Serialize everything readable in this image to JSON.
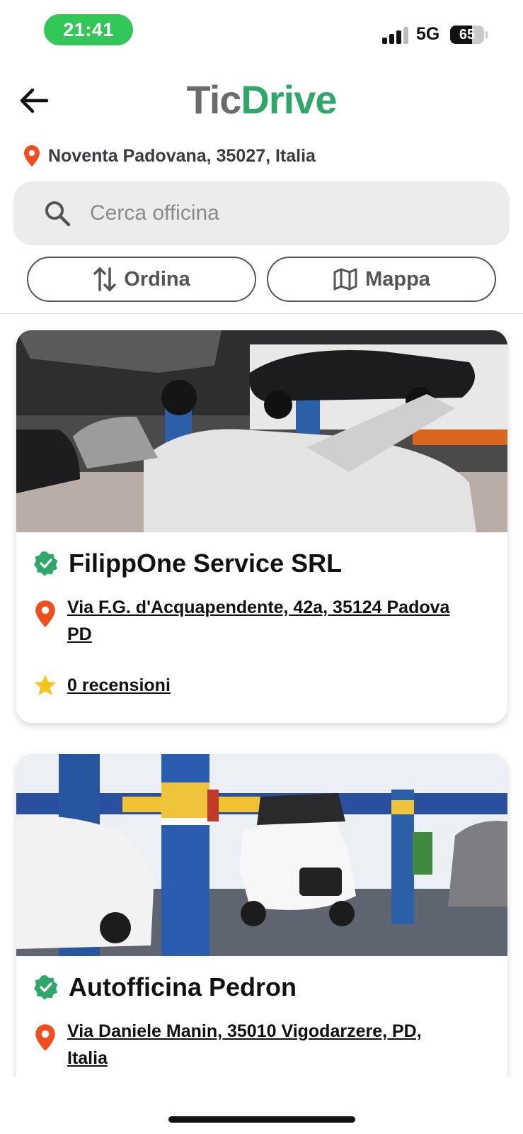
{
  "status_bar": {
    "time": "21:41",
    "network": "5G",
    "battery": "65",
    "battery_level": 0.65
  },
  "header": {
    "logo_part1": "Tic",
    "logo_part2": "Drive",
    "back_icon": "arrow-left-icon"
  },
  "location": {
    "text": "Noventa Padovana, 35027, Italia",
    "icon": "map-pin-icon"
  },
  "search": {
    "placeholder": "Cerca officina",
    "icon": "search-icon"
  },
  "actions": {
    "sort_label": "Ordina",
    "sort_icon": "sort-arrows-icon",
    "map_label": "Mappa",
    "map_icon": "map-icon"
  },
  "workshops": [
    {
      "name": "FilippOne Service SRL",
      "address": "Via F.G. d'Acquapendente, 42a, 35124 Padova PD",
      "reviews": "0 recensioni",
      "verified_icon": "verified-badge-icon"
    },
    {
      "name": "Autofficina Pedron",
      "address": "Via Daniele Manin, 35010 Vigodarzere, PD, Italia",
      "verified_icon": "verified-badge-icon"
    }
  ],
  "colors": {
    "brand_green": "#2fa66a",
    "time_pill": "#33c759",
    "pin_orange": "#f04e1c",
    "star_yellow": "#f5c518"
  }
}
